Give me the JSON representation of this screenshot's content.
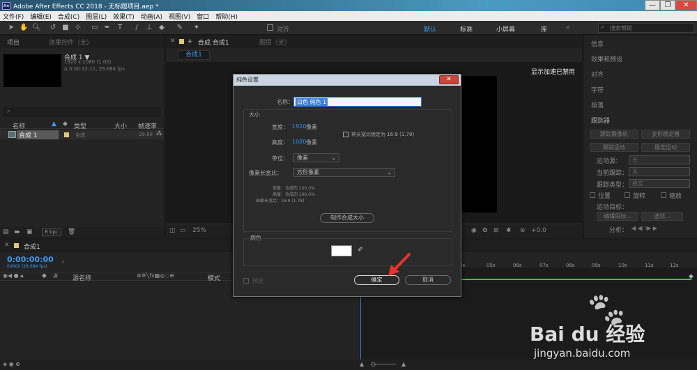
{
  "app": {
    "title": "Adobe After Effects CC 2018 - 无标题项目.aep *",
    "logo": "Ae"
  },
  "window_controls": {
    "minimize": "—",
    "restore": "❐",
    "close": "✕"
  },
  "menu": [
    "文件(F)",
    "编辑(E)",
    "合成(C)",
    "图层(L)",
    "效果(T)",
    "动画(A)",
    "视图(V)",
    "窗口",
    "帮助(H)"
  ],
  "toolbar": {
    "snap_label": "对齐",
    "workspaces": [
      "默认",
      "标准",
      "小屏幕",
      "库"
    ],
    "search_placeholder": "搜索帮助"
  },
  "project_panel": {
    "tab_project": "项目",
    "tab_effects": "效果控件（无）",
    "comp_name": "合成 1 ▼",
    "comp_size": "1920 x 1080 (1.00)",
    "comp_duration": "Δ 0:00:12:11, 29.684 fps",
    "columns": [
      "名称",
      "类型",
      "大小",
      "帧速率"
    ],
    "row": {
      "name": "合成 1",
      "type": "合成",
      "fps": "29.68"
    },
    "bpc": "8 bpc"
  },
  "viewer": {
    "tab_comp": "合成 合成1",
    "tab_layer": "图层（无）",
    "sub_tab": "合成1",
    "accel_msg": "显示加速已禁用",
    "zoom": "25%",
    "exposure": "+0.0"
  },
  "right_panels": {
    "items": [
      "信息",
      "效果和预设",
      "对齐",
      "字符",
      "段落"
    ],
    "tracker_title": "跟踪器",
    "buttons": [
      "跟踪摄像机",
      "变形稳定器",
      "跟踪运动",
      "稳定运动"
    ],
    "fields": [
      {
        "label": "运动源：",
        "value": "无"
      },
      {
        "label": "当前跟踪：",
        "value": "无"
      },
      {
        "label": "跟踪类型：",
        "value": "稳定"
      }
    ],
    "checks": [
      "位置",
      "旋转",
      "缩放"
    ],
    "motion_target": "运动目标：",
    "edit_target": "编辑目标...",
    "options": "选项...",
    "analyze": "分析："
  },
  "timeline": {
    "tab": "合成1",
    "timecode": "0:00:00:00",
    "timecode_sub": "00000 (29.684 fps)",
    "col_source": "源名称",
    "col_mode": "模式",
    "ruler": [
      "0s",
      "05s",
      "06s",
      "07s",
      "08s",
      "09s",
      "10s",
      "11s",
      "12s"
    ]
  },
  "dialog": {
    "title": "纯色设置",
    "close": "✕",
    "name_label": "名称：",
    "name_value": "白色 纯色 1",
    "size_group": "大小",
    "width_label": "宽度：",
    "width_value": "1920",
    "height_label": "高度：",
    "height_value": "1080",
    "px_unit": "像素",
    "lock_label": "将长宽比锁定为 16:9 (1.78)",
    "unit_label": "单位：",
    "unit_value": "像素",
    "par_label": "像素长宽比：",
    "par_value": "方形像素",
    "info_width": "宽度：合成的 100.0%",
    "info_height": "高度：合成的 100.0%",
    "info_ratio": "画面长宽比：16:9 (1.78)",
    "make_comp_size": "制作合成大小",
    "color_group": "颜色",
    "color_value": "#ffffff",
    "preview": "预览",
    "ok": "确定",
    "cancel": "取消"
  },
  "watermark": {
    "brand": "Bai du 经验",
    "url": "jingyan.baidu.com"
  },
  "colors": {
    "accent": "#2d8ceb",
    "arrow": "#e8322a",
    "timeline_green": "#2bd12b"
  }
}
